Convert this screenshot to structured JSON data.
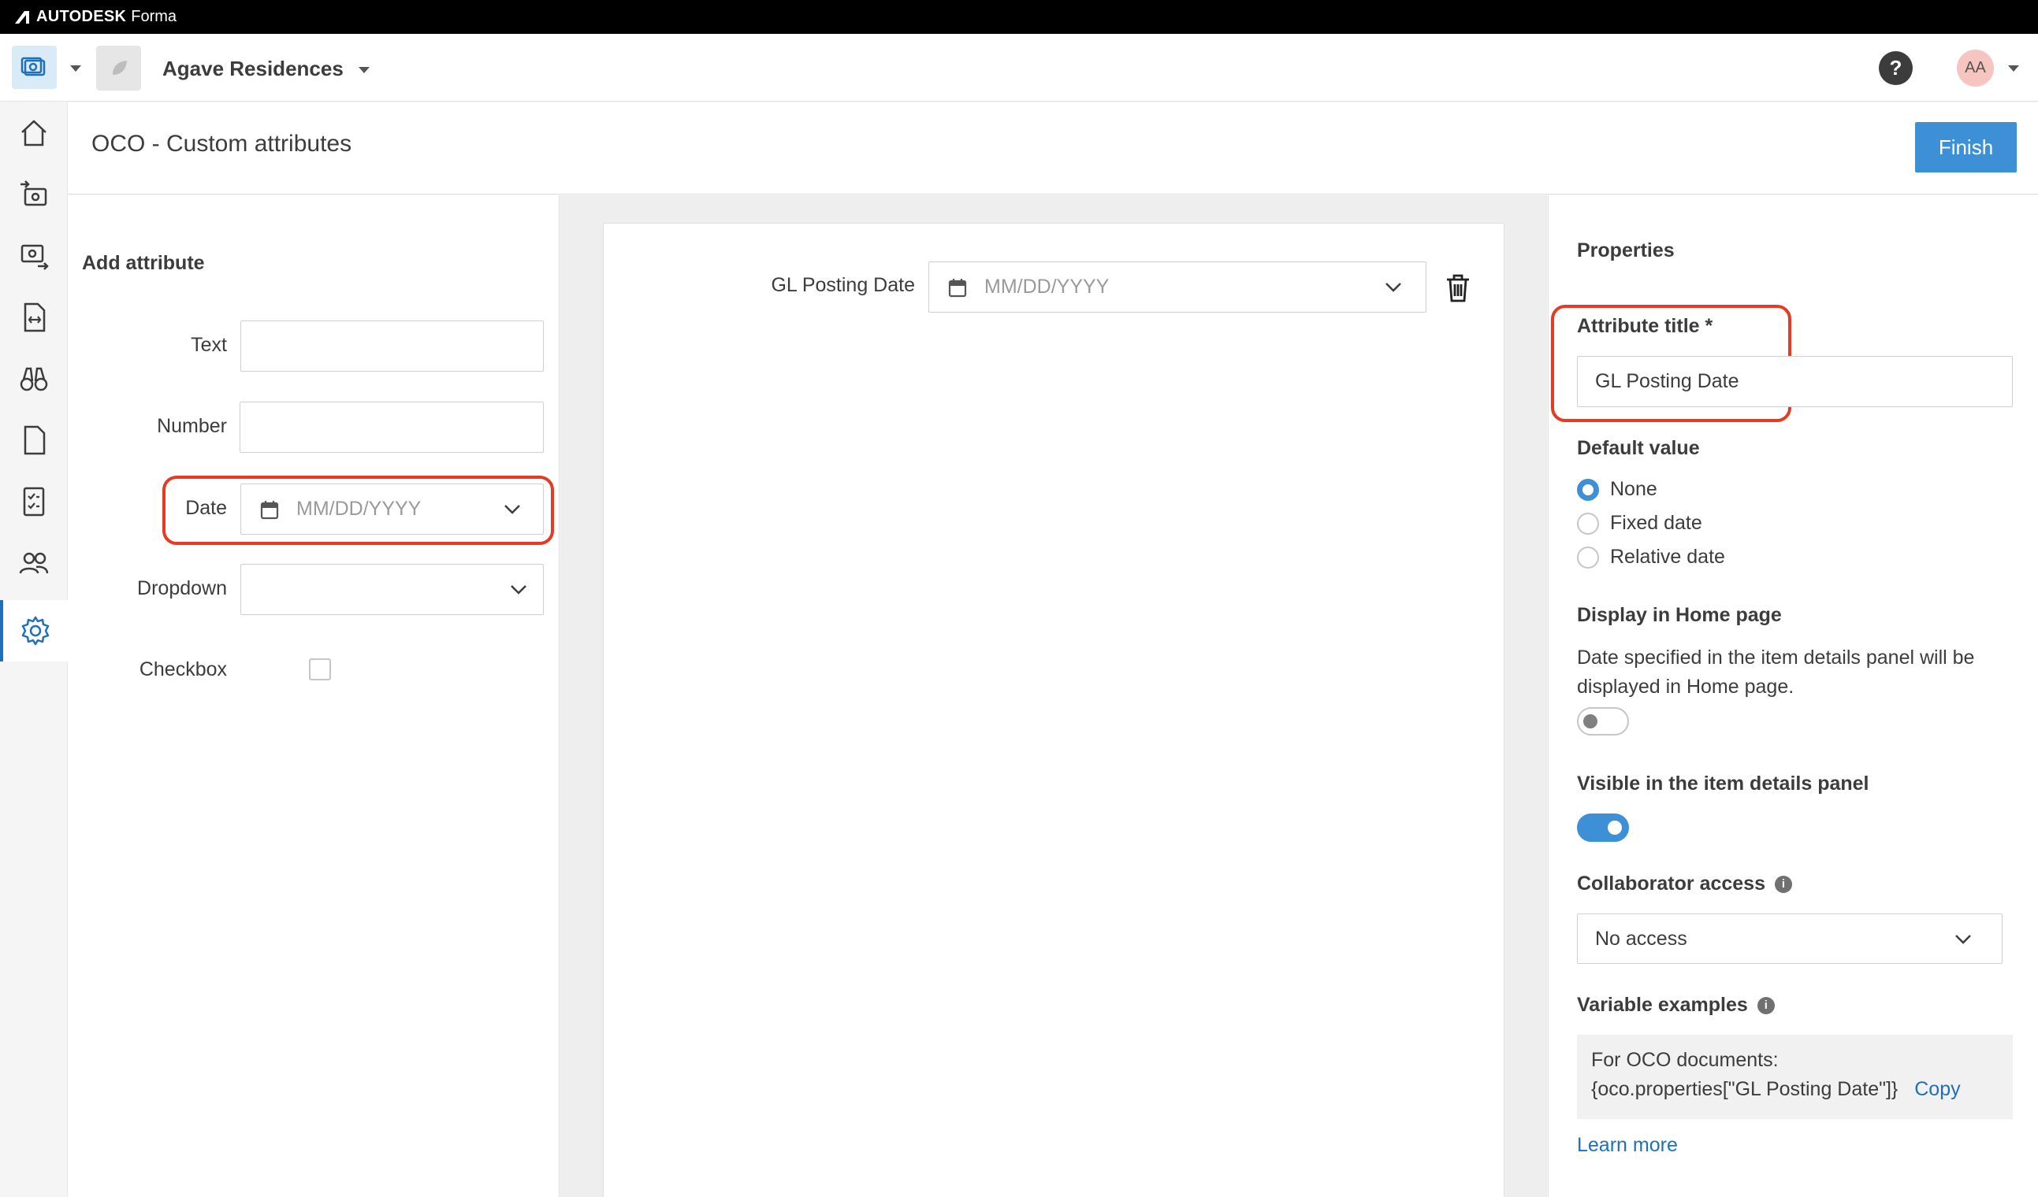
{
  "brand": {
    "name": "AUTODESK",
    "product": "Forma"
  },
  "header": {
    "project_name": "Agave Residences",
    "help_label": "?",
    "avatar_initials": "AA"
  },
  "rail": {
    "items": [
      "home-icon",
      "cost-inbound-icon",
      "cost-outbound-icon",
      "documents-icon",
      "search-binoculars-icon",
      "file-icon",
      "checklist-icon",
      "members-icon",
      "settings-icon"
    ],
    "active": "settings-icon"
  },
  "page": {
    "title": "OCO - Custom attributes",
    "finish_label": "Finish"
  },
  "add_attribute": {
    "title": "Add attribute",
    "text_label": "Text",
    "number_label": "Number",
    "date_label": "Date",
    "date_placeholder": "MM/DD/YYYY",
    "dropdown_label": "Dropdown",
    "checkbox_label": "Checkbox"
  },
  "canvas": {
    "field_label": "GL Posting Date",
    "date_placeholder": "MM/DD/YYYY"
  },
  "properties": {
    "title": "Properties",
    "attribute_title_label": "Attribute title *",
    "attribute_title_value": "GL Posting Date",
    "default_value_label": "Default value",
    "radio_none": "None",
    "radio_fixed": "Fixed date",
    "radio_relative": "Relative date",
    "display_home_label": "Display in Home page",
    "display_home_desc": "Date specified in the item details panel will be displayed in Home page.",
    "visible_details_label": "Visible in the item details panel",
    "collab_access_label": "Collaborator access",
    "collab_access_value": "No access",
    "variable_examples_label": "Variable examples",
    "var_line1": "For OCO documents:",
    "var_line2": "{oco.properties[\"GL Posting Date\"]}",
    "copy_label": "Copy",
    "learn_more": "Learn more"
  },
  "colors": {
    "accent": "#3d8fd6",
    "highlight": "#e53b25",
    "brand_bar": "#000000"
  }
}
